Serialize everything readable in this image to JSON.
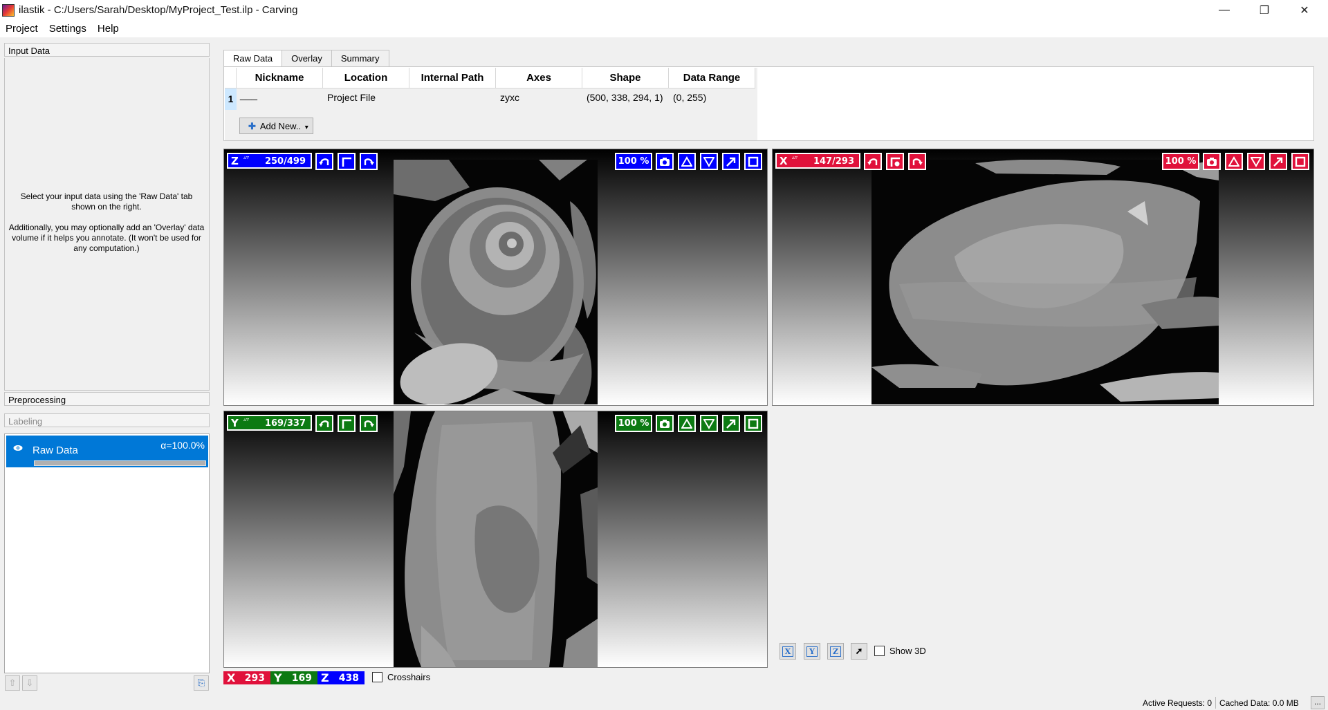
{
  "window": {
    "title": "ilastik - C:/Users/Sarah/Desktop/MyProject_Test.ilp - Carving",
    "min_glyph": "—",
    "max_glyph": "❐",
    "close_glyph": "✕"
  },
  "menu": [
    "Project",
    "Settings",
    "Help"
  ],
  "sidebar": {
    "input_data_header": "Input Data",
    "help_text_1": "Select your input data using the 'Raw Data' tab shown on the right.",
    "help_text_2": "Additionally, you may optionally add an 'Overlay' data volume if it helps you annotate. (It won't be used for any computation.)",
    "preprocessing_header": "Preprocessing",
    "labeling_header": "Labeling",
    "layer": {
      "name": "Raw Data",
      "opacity": "α=100.0%",
      "opacity_fraction": 1.0,
      "eye_icon": "eye-icon"
    },
    "up_glyph": "⇧",
    "down_glyph": "⇩",
    "export_glyph": "⎘"
  },
  "tabs": [
    "Raw Data",
    "Overlay",
    "Summary"
  ],
  "active_tab": "Raw Data",
  "table": {
    "headers": [
      "Nickname",
      "Location",
      "Internal Path",
      "Axes",
      "Shape",
      "Data Range"
    ],
    "rows": [
      {
        "num": "1",
        "nickname": "___",
        "location": "Project File",
        "internal_path": "",
        "axes": "zyxc",
        "shape": "(500, 338, 294, 1)",
        "range": "(0, 255)"
      }
    ],
    "add_new_label": "Add New..",
    "add_new_plus": "✚",
    "add_new_arrow": "▾"
  },
  "viewers": {
    "z": {
      "axis": "Z",
      "spin": "▵▿",
      "position": "250/499",
      "zoom": "100 %",
      "color": "#0000ff"
    },
    "x": {
      "axis": "X",
      "spin": "▵▿",
      "position": "147/293",
      "zoom": "100 %",
      "color": "#e0113b"
    },
    "y": {
      "axis": "Y",
      "spin": "▵▿",
      "position": "169/337",
      "zoom": "100 %",
      "color": "#0c7a12"
    }
  },
  "position_bar": {
    "x_label": "X",
    "x_value": "293",
    "y_label": "Y",
    "y_value": "169",
    "z_label": "Z",
    "z_value": "438",
    "crosshairs_label": "Crosshairs",
    "crosshairs_checked": false
  },
  "view_controls": {
    "x_btn": "X",
    "y_btn": "Y",
    "z_btn": "Z",
    "maximize_glyph": "➚",
    "show3d_label": "Show 3D",
    "show3d_checked": false
  },
  "status": {
    "active_requests": "Active Requests: 0",
    "cached_data": "Cached Data: 0.0 MB",
    "more_label": "..."
  }
}
